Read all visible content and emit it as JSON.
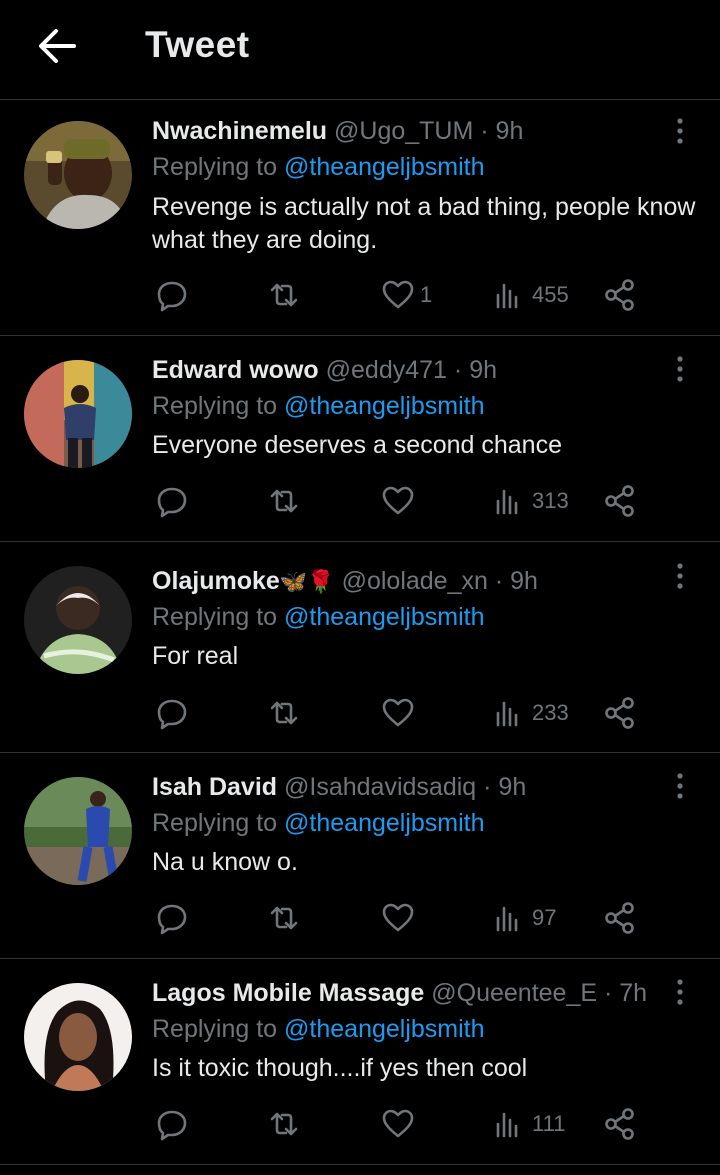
{
  "header": {
    "title": "Tweet"
  },
  "replies": [
    {
      "name": "Nwachinemelu",
      "handle": "@Ugo_TUM",
      "dot": "·",
      "time": "9h",
      "replying_label": "Replying to",
      "replying_to": "@theangeljbsmith",
      "text": "Revenge is actually not a bad thing, people know what they are doing.",
      "likes": "1",
      "views": "455"
    },
    {
      "name": "Edward wowo",
      "handle": "@eddy471",
      "dot": "·",
      "time": "9h",
      "replying_label": "Replying to",
      "replying_to": "@theangeljbsmith",
      "text": "Everyone deserves a second chance",
      "likes": "",
      "views": "313"
    },
    {
      "name": "Olajumoke",
      "name_emoji": "🦋🌹",
      "handle": "@ololade_xn",
      "dot": "·",
      "time": "9h",
      "replying_label": "Replying to",
      "replying_to": "@theangeljbsmith",
      "text": "For real",
      "likes": "",
      "views": "233"
    },
    {
      "name": "Isah David",
      "handle": "@Isahdavidsadiq",
      "dot": "·",
      "time": "9h",
      "replying_label": "Replying to",
      "replying_to": "@theangeljbsmith",
      "text": "Na u know o.",
      "likes": "",
      "views": "97"
    },
    {
      "name": "Lagos Mobile Massage",
      "handle": "@Queentee_E",
      "dot": "·",
      "time": "7h",
      "replying_label": "Replying to",
      "replying_to": "@theangeljbsmith",
      "text": "Is it toxic though....if yes then cool",
      "likes": "",
      "views": "111"
    }
  ],
  "colors": {
    "background": "#000000",
    "text": "#e7e9ea",
    "muted": "#71767b",
    "link": "#1d9bf0",
    "divider": "#2f3336"
  }
}
